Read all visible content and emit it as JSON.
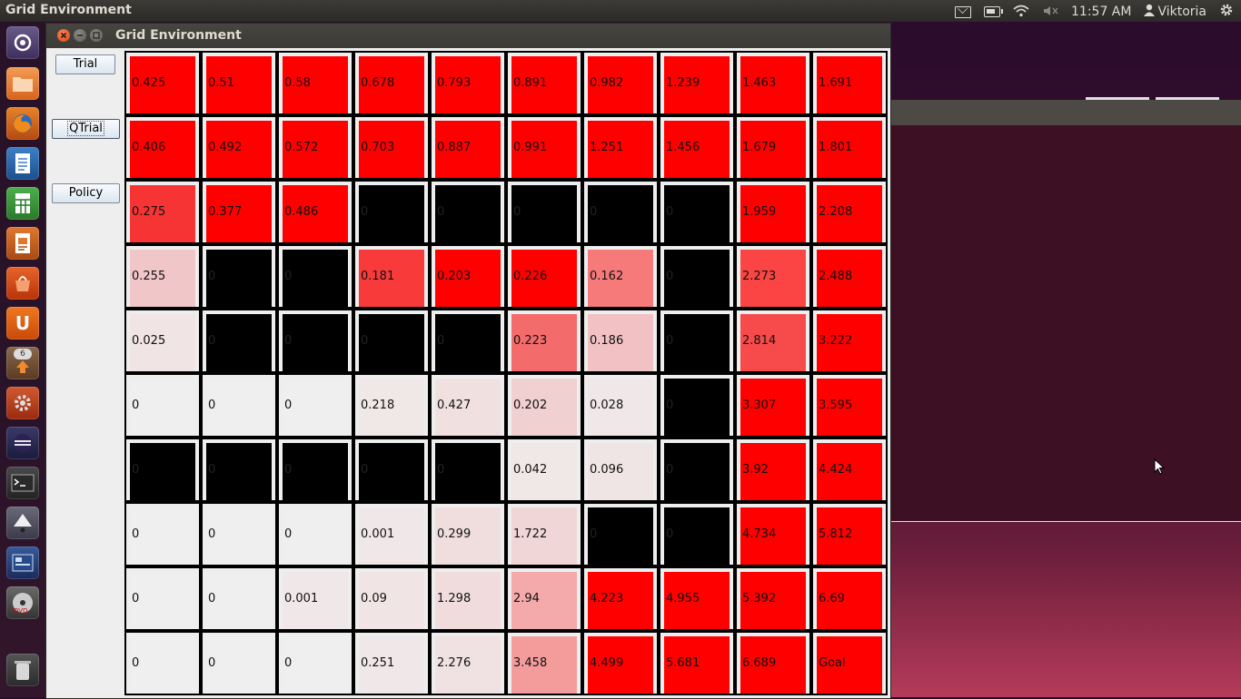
{
  "topbar": {
    "app_title": "Grid Environment",
    "time": "11:57 AM",
    "user": "Viktoria"
  },
  "window": {
    "title": "Grid Environment"
  },
  "buttons": {
    "trial": "Trial",
    "qtrial": "QTrial",
    "policy": "Policy"
  },
  "launcher": {
    "icons": [
      "ubuntu-dash-icon",
      "files-icon",
      "firefox-icon",
      "writer-icon",
      "calc-icon",
      "impress-icon",
      "software-center-icon",
      "ubuntu-one-icon",
      "updates-icon",
      "system-settings-icon",
      "eclipse-icon",
      "terminal-icon",
      "inkscape-icon",
      "workspaces-icon",
      "dvd-icon",
      "trash-icon"
    ],
    "update_badge": "6"
  },
  "grid": {
    "rows": [
      [
        "0.425",
        "0.51",
        "0.58",
        "0.678",
        "0.793",
        "0.891",
        "0.982",
        "1.239",
        "1.463",
        "1.691"
      ],
      [
        "0.406",
        "0.492",
        "0.572",
        "0.703",
        "0.887",
        "0.991",
        "1.251",
        "1.456",
        "1.679",
        "1.801"
      ],
      [
        "0.275",
        "0.377",
        "0.486",
        "0",
        "0",
        "0",
        "0",
        "0",
        "1.959",
        "2.208"
      ],
      [
        "0.255",
        "0",
        "0",
        "0.181",
        "0.203",
        "0.226",
        "0.162",
        "0",
        "2.273",
        "2.488"
      ],
      [
        "0.025",
        "0",
        "0",
        "0",
        "0",
        "0.223",
        "0.186",
        "0",
        "2.814",
        "3.222"
      ],
      [
        "0",
        "0",
        "0",
        "0.218",
        "0.427",
        "0.202",
        "0.028",
        "0",
        "3.307",
        "3.595"
      ],
      [
        "0",
        "0",
        "0",
        "0",
        "0",
        "0.042",
        "0.096",
        "0",
        "3.92",
        "4.424"
      ],
      [
        "0",
        "0",
        "0",
        "0.001",
        "0.299",
        "1.722",
        "0",
        "0",
        "4.734",
        "5.812"
      ],
      [
        "0",
        "0",
        "0.001",
        "0.09",
        "1.298",
        "2.94",
        "4.223",
        "4.955",
        "5.392",
        "6.69"
      ],
      [
        "0",
        "0",
        "0",
        "0.251",
        "2.276",
        "3.458",
        "4.499",
        "5.681",
        "6.689",
        "Goal"
      ]
    ],
    "colors": [
      [
        "#ff0000",
        "#ff0000",
        "#ff0000",
        "#ff0000",
        "#ff0000",
        "#ff0000",
        "#ff0000",
        "#ff0000",
        "#ff0000",
        "#ff0000"
      ],
      [
        "#ff0000",
        "#ff0000",
        "#ff0000",
        "#ff0000",
        "#ff0000",
        "#ff0000",
        "#ff0000",
        "#ff0000",
        "#ff0000",
        "#ff0000"
      ],
      [
        "#f73434",
        "#ff0000",
        "#ff0000",
        "#000000",
        "#000000",
        "#000000",
        "#000000",
        "#000000",
        "#ff0000",
        "#ff0000"
      ],
      [
        "#f1c6c9",
        "#000000",
        "#000000",
        "#f83a3a",
        "#ff0000",
        "#ff0000",
        "#f67a7a",
        "#000000",
        "#fb4444",
        "#ff0000"
      ],
      [
        "#f0e4e5",
        "#000000",
        "#000000",
        "#000000",
        "#000000",
        "#f36b6b",
        "#f1c1c3",
        "#000000",
        "#f74a4a",
        "#ff0000"
      ],
      [
        "#f0efef",
        "#f0efef",
        "#f0efef",
        "#f0e7e7",
        "#f0e0e0",
        "#f0d0d0",
        "#f0e8e8",
        "#000000",
        "#ff0000",
        "#ff0000"
      ],
      [
        "#000000",
        "#000000",
        "#000000",
        "#000000",
        "#000000",
        "#f0e7e7",
        "#f0e5e5",
        "#000000",
        "#ff0000",
        "#ff0000"
      ],
      [
        "#f0efef",
        "#f0efef",
        "#f0efef",
        "#f0e8e8",
        "#f0dede",
        "#f0d6d6",
        "#000000",
        "#000000",
        "#ff0000",
        "#ff0000"
      ],
      [
        "#f0efef",
        "#f0efef",
        "#f0e8e8",
        "#f0e4e4",
        "#f0dcdc",
        "#f4aaaa",
        "#ff0000",
        "#ff0000",
        "#ff0000",
        "#ff0000"
      ],
      [
        "#f0efef",
        "#f0efef",
        "#f0efef",
        "#f0e8e8",
        "#f0e2e2",
        "#f49c9c",
        "#ff0000",
        "#ff0000",
        "#ff0000",
        "#ff0000"
      ]
    ]
  },
  "accent": {
    "close_button": "#e95420",
    "launcher_bg": "#2c1a2c"
  }
}
